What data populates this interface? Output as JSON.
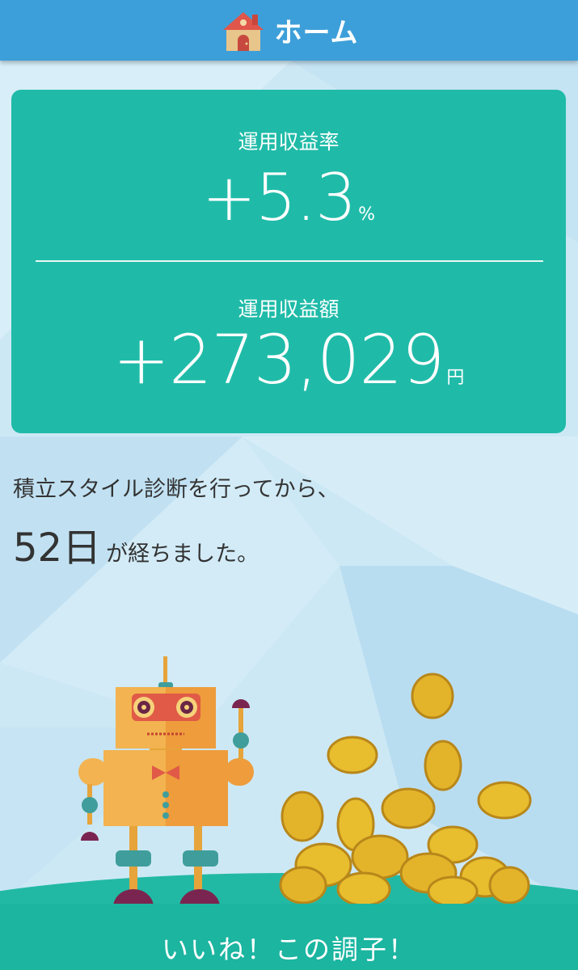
{
  "header": {
    "title": "ホーム",
    "icon": "house-icon"
  },
  "summary": {
    "rate_label": "運用収益率",
    "rate_value": "+5.3",
    "rate_unit": "%",
    "amount_label": "運用収益額",
    "amount_value": "+273,029",
    "amount_unit": "円"
  },
  "diagnosis": {
    "intro": "積立スタイル診断を行ってから、",
    "days": "52",
    "days_unit": "日",
    "suffix": "が経ちました。"
  },
  "footer": {
    "message": "いいね！この調子！"
  },
  "colors": {
    "header": "#3d9fd9",
    "card": "#1fbba8",
    "footer": "#1bb5a0"
  }
}
